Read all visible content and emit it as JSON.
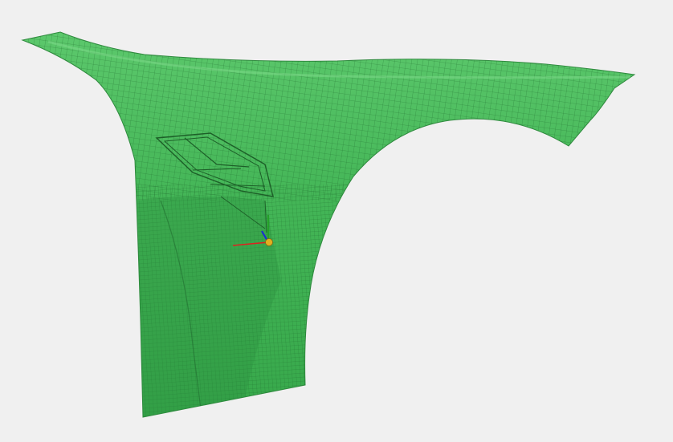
{
  "viewport": {
    "background": "#f0f0f0",
    "part": {
      "name": "front-fender-mesh",
      "surface_color": "#3fb354",
      "surface_light": "#5cc86c",
      "surface_shadow": "#2f9a44",
      "mesh_line_color": "#1f6b2c"
    },
    "triad": {
      "x_axis_color": "#e02020",
      "y_axis_color": "#20a020",
      "z_axis_color": "#1a2fd0",
      "origin_color": "#e0b020"
    }
  }
}
